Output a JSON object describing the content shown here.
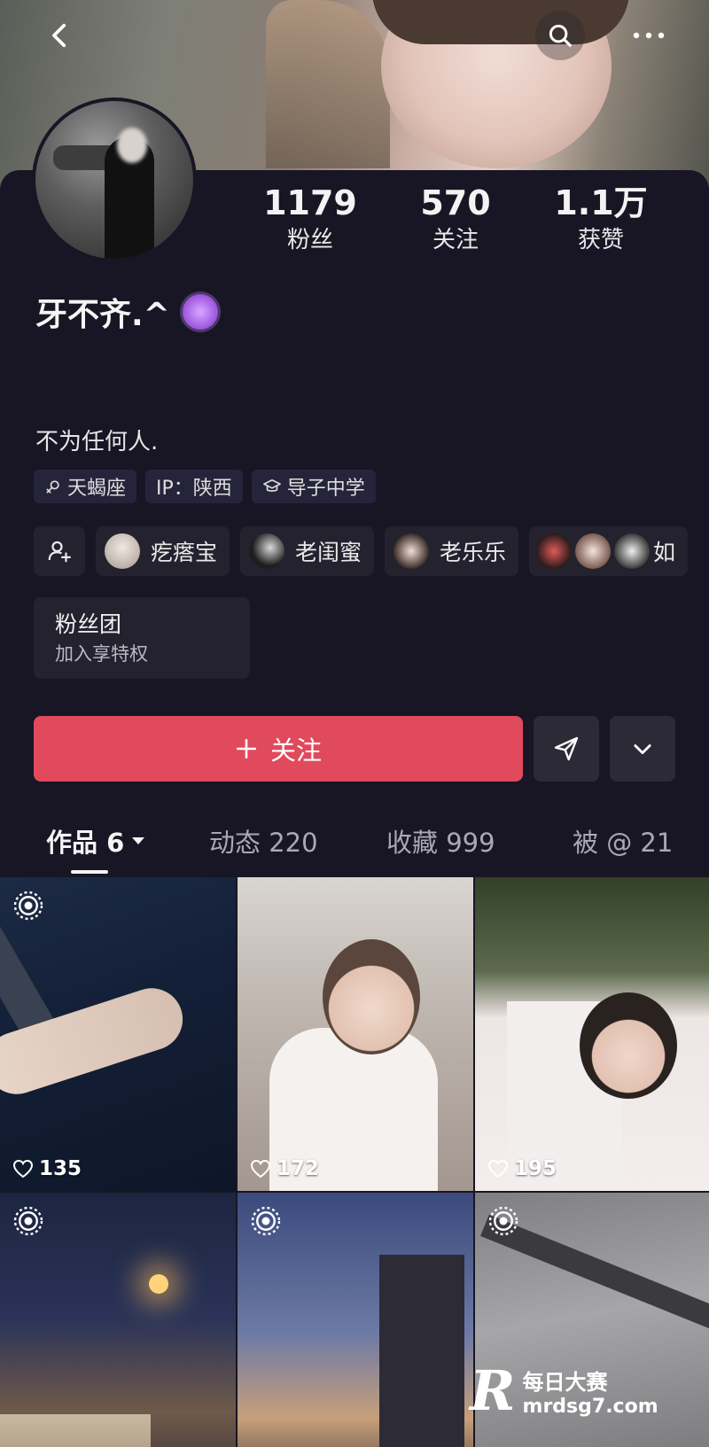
{
  "header": {
    "back_icon": "chevron-left-icon",
    "search_icon": "search-icon",
    "more_icon": "more-dots-icon"
  },
  "profile": {
    "nickname": "牙不齐.^",
    "bio": "不为任何人.",
    "stats": [
      {
        "num": "1179",
        "label": "粉丝"
      },
      {
        "num": "570",
        "label": "关注"
      },
      {
        "num": "1.1万",
        "label": "获赞"
      }
    ],
    "tags": [
      {
        "icon": "female-symbol-icon",
        "text": "天蝎座"
      },
      {
        "icon": "",
        "text": "IP：陕西"
      },
      {
        "icon": "graduation-cap-icon",
        "text": "导子中学"
      }
    ],
    "friends": [
      {
        "label": "疙瘩宝",
        "color": "#c9c2bc"
      },
      {
        "label": "老闺蜜",
        "color": "#3a3a3a"
      },
      {
        "label": "老乐乐",
        "color": "#d9c8c2"
      }
    ],
    "friends_more_label": "如",
    "fanclub": {
      "title": "粉丝团",
      "subtitle": "加入享特权"
    }
  },
  "actions": {
    "follow_label": "关注",
    "accent_color": "#e04a5c"
  },
  "tabs": [
    {
      "label": "作品 6",
      "active": true
    },
    {
      "label": "动态 220",
      "active": false
    },
    {
      "label": "收藏 999",
      "active": false
    },
    {
      "label": "被 @ 21",
      "active": false
    }
  ],
  "posts": [
    {
      "likes": "135"
    },
    {
      "likes": "172"
    },
    {
      "likes": "195"
    },
    {
      "likes": ""
    },
    {
      "likes": ""
    },
    {
      "likes": ""
    }
  ],
  "watermark": {
    "logo_letter": "R",
    "line1": "每日大赛",
    "line2": "mrdsg7.com"
  }
}
